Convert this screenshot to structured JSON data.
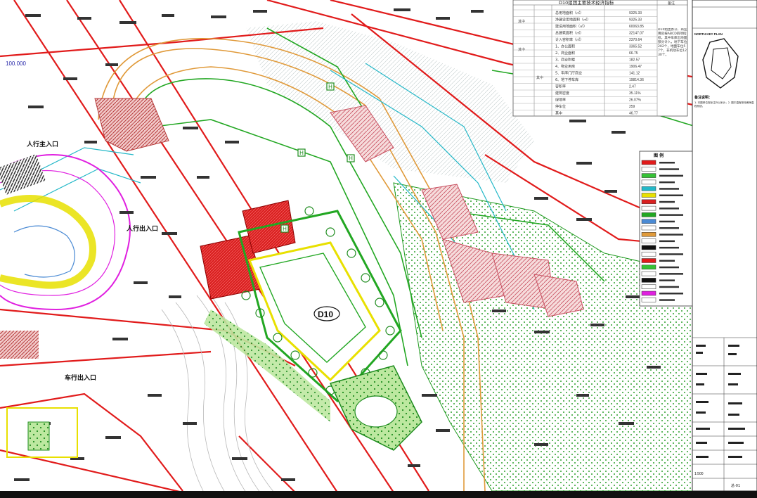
{
  "drawing": {
    "table_title": "D10组团主要技术经济指标",
    "table_rows": [
      {
        "label": "总用地面积（㎡）",
        "value": "9325.33"
      },
      {
        "label": "净建设用地面积（㎡）",
        "value": "9325.33"
      },
      {
        "label": "建设用地面积（㎡）",
        "value": "60063.85"
      },
      {
        "label": "总建筑面积（㎡）",
        "value": "32147.07"
      },
      {
        "label": "计入容积率（㎡）",
        "value": "2370.64"
      },
      {
        "label": "1、办公面积",
        "value": "3365.52"
      },
      {
        "label": "2、商业面积",
        "value": "66.75"
      },
      {
        "label": "3、商业附楼",
        "value": "182.57"
      },
      {
        "label": "4、物业用房",
        "value": "1906.47"
      },
      {
        "label": "5、车库门厅商业",
        "value": "141.12"
      },
      {
        "label": "6、地下停车库",
        "value": "19814.36"
      },
      {
        "label": "容积率",
        "value": "2.47"
      },
      {
        "label": "建筑密度",
        "value": "35.11%"
      },
      {
        "label": "绿地率",
        "value": "26.07%"
      },
      {
        "label": "停车位",
        "value": "259"
      },
      {
        "label": "其中",
        "value": "46.77"
      }
    ],
    "table_side_col_1": "其中",
    "table_side_col_2": "其中",
    "table_side_col_3": "其中",
    "table_remark_header": "备注",
    "table_remark_text": "D10组团办公、商业用房按ABCD四项指标，其中车库出地面部分计入，地下车位202个，地面车位57个，非机动车位1230个。",
    "label_pedestrian_main": "人行主入口",
    "label_pedestrian_entry": "人行出入口",
    "label_vehicle_entry": "车行出入口",
    "label_block_d10": "D10",
    "label_elev_left": "100.000",
    "label_north": "NORTH KEY PLAN",
    "label_legend": "图 例",
    "label_notes_title": "备注说明：",
    "label_notes_text": "1. 本图单位除标注外以米计；2. 图中高程采用黄海高程系统。",
    "label_scale": "1:500",
    "label_drawing_no": "总-01"
  },
  "colors": {
    "road_red": "#e11b1b",
    "site_red": "#d92020",
    "green_line": "#22a722",
    "yellow_line": "#e8e000",
    "cyan_line": "#24b8c8",
    "magenta": "#e020e0",
    "grass": "#36c236",
    "orange_line": "#e09a3a",
    "pink_hatch": "#c85060"
  }
}
